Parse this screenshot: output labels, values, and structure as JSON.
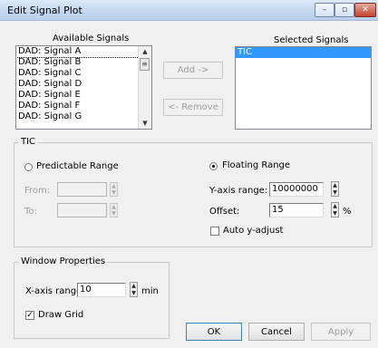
{
  "window": {
    "title": "Edit Signal Plot",
    "min_glyph": "–",
    "max_glyph": "▫",
    "close_glyph": "✕"
  },
  "available": {
    "header": "Available Signals",
    "items": [
      "DAD: Signal A",
      "DAD: Signal B",
      "DAD: Signal C",
      "DAD: Signal D",
      "DAD: Signal E",
      "DAD: Signal F",
      "DAD: Signal G"
    ]
  },
  "selected": {
    "header": "Selected Signals",
    "items": [
      "TIC"
    ]
  },
  "buttons": {
    "add": "Add ->",
    "remove": "<- Remove",
    "ok": "OK",
    "cancel": "Cancel",
    "apply": "Apply"
  },
  "tic": {
    "group_title": "TIC",
    "predictable_label": "Predictable Range",
    "floating_label": "Floating Range",
    "mode": "floating",
    "from_label": "From:",
    "to_label": "To:",
    "from_value": "",
    "to_value": "",
    "yrange_label": "Y-axis range:",
    "yrange_value": "10000000",
    "offset_label": "Offset:",
    "offset_value": "15",
    "offset_unit": "%",
    "auto_adjust_label": "Auto y-adjust",
    "auto_adjust_checked": false
  },
  "window_props": {
    "group_title": "Window Properties",
    "xrange_label": "X-axis range:",
    "xrange_value": "10",
    "xrange_unit": "min",
    "draw_grid_label": "Draw Grid",
    "draw_grid_checked": true
  }
}
